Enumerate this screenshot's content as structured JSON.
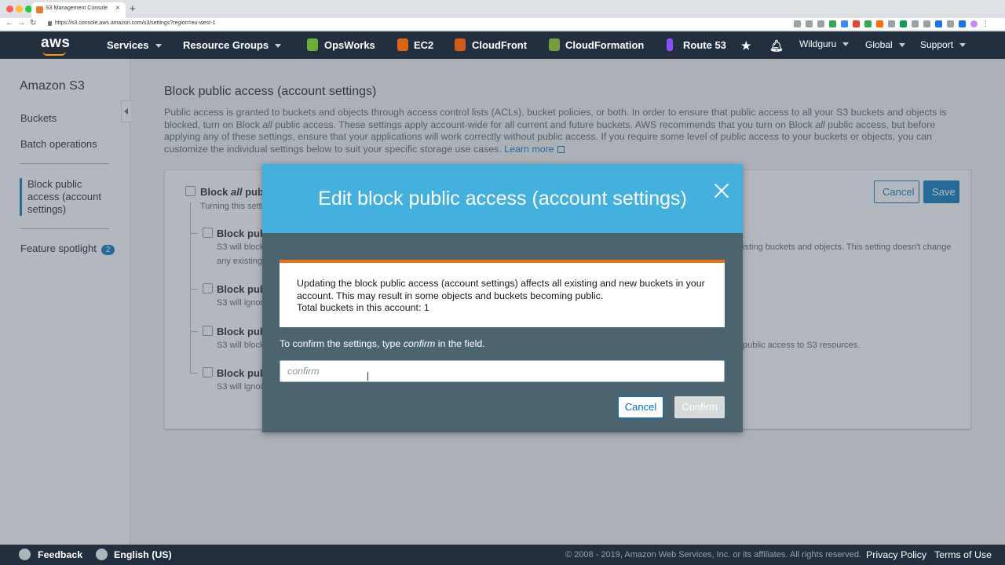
{
  "browser": {
    "tab_title": "S3 Management Console",
    "url": "https://s3.console.aws.amazon.com/s3/settings?region=eu-west-1"
  },
  "header": {
    "logo": "aws",
    "services": "Services",
    "resource_groups": "Resource Groups",
    "shortcuts": [
      "OpsWorks",
      "EC2",
      "CloudFront",
      "CloudFormation",
      "Route 53"
    ],
    "user": "Wildguru",
    "region": "Global",
    "support": "Support"
  },
  "sidebar": {
    "title": "Amazon S3",
    "items": [
      "Buckets",
      "Batch operations"
    ],
    "active_item": "Block public access (account settings)",
    "feature_spotlight": "Feature spotlight",
    "feature_count": "2"
  },
  "main": {
    "title": "Block public access (account settings)",
    "description_1": "Public access is granted to buckets and objects through access control lists (ACLs), bucket policies, or both. In order to ensure that public access to all your S3 buckets and objects is blocked, turn on Block ",
    "description_em_1": "all",
    "description_2": " public access. These settings apply account-wide for all current and future buckets. AWS recommends that you turn on Block ",
    "description_em_2": "all",
    "description_3": " public access, but before applying any of these settings, ensure that your applications will work correctly without public access. If you require some level of public access to your buckets or objects, you can customize the individual settings below to suit your specific storage use cases. ",
    "learn_more": "Learn more",
    "panel": {
      "block_all_prefix": "Block ",
      "block_all_em": "all",
      "block_all_suffix": " publ",
      "block_all_sub": "Turning this setti",
      "options": [
        {
          "label": "Block pub",
          "sub": "S3 will block",
          "sub2": "any existing"
        },
        {
          "label": "Block pub",
          "sub": "S3 will ignor"
        },
        {
          "label": "Block pub",
          "sub": "S3 will block"
        },
        {
          "label": "Block pub",
          "sub": "S3 will ignor"
        }
      ],
      "right_text_1": "isting buckets and objects. This setting doesn't change",
      "right_text_2": "public access to S3 resources.",
      "cancel": "Cancel",
      "save": "Save"
    }
  },
  "modal": {
    "title": "Edit block public access (account settings)",
    "alert_line_1": "Updating the block public access (account settings) affects all existing and new buckets in your account. This may result in some objects and buckets becoming public.",
    "alert_line_2": "Total buckets in this account: 1",
    "confirm_prefix": "To confirm the settings, type ",
    "confirm_em": "confirm",
    "confirm_suffix": " in the field.",
    "input_placeholder": "confirm",
    "input_value": "",
    "cancel": "Cancel",
    "confirm": "Confirm"
  },
  "footer": {
    "feedback": "Feedback",
    "language": "English (US)",
    "copyright": "© 2008 - 2019, Amazon Web Services, Inc. or its affiliates. All rights reserved.",
    "privacy": "Privacy Policy",
    "terms": "Terms of Use"
  },
  "colors": {
    "header_bg": "#232f3e",
    "accent": "#ff9900",
    "link": "#0073bb",
    "modal_header": "#44b0de",
    "modal_body": "#4c6370",
    "alert_border": "#ec7211"
  }
}
